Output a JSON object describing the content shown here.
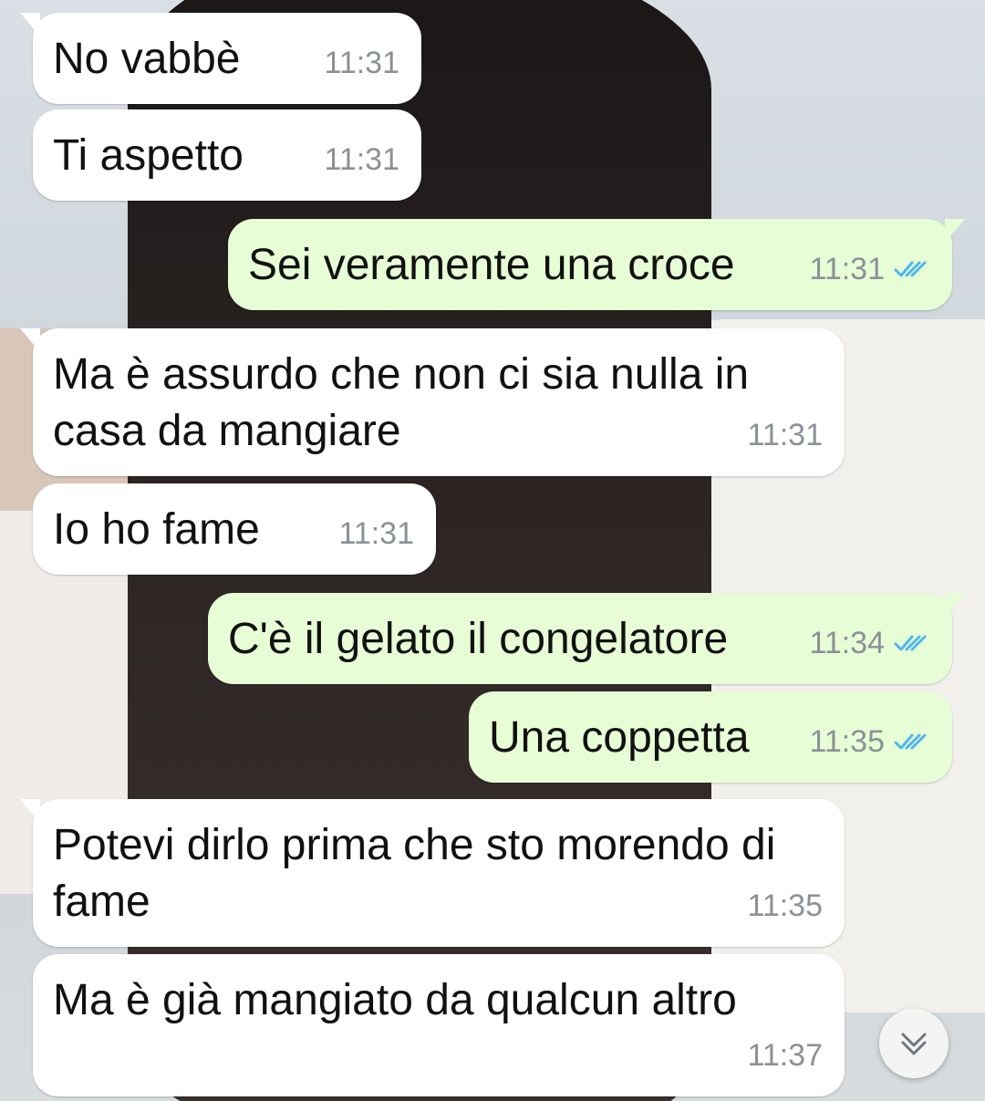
{
  "colors": {
    "incoming_bubble": "#ffffff",
    "outgoing_bubble": "#e7fdd6",
    "read_ticks": "#4fb6ec",
    "timestamp": "#8a9297"
  },
  "messages": [
    {
      "direction": "incoming",
      "text": "No vabbè",
      "time": "11:31"
    },
    {
      "direction": "incoming",
      "text": "Ti aspetto",
      "time": "11:31"
    },
    {
      "direction": "outgoing",
      "text": "Sei veramente una croce",
      "time": "11:31",
      "status_icon": "double-check-read-icon"
    },
    {
      "direction": "incoming",
      "text": "Ma è assurdo che non ci sia nulla in casa da mangiare",
      "time": "11:31"
    },
    {
      "direction": "incoming",
      "text": "Io ho fame",
      "time": "11:31"
    },
    {
      "direction": "outgoing",
      "text": "C'è il gelato il congelatore",
      "time": "11:34",
      "status_icon": "double-check-read-icon"
    },
    {
      "direction": "outgoing",
      "text": "Una coppetta",
      "time": "11:35",
      "status_icon": "double-check-read-icon"
    },
    {
      "direction": "incoming",
      "text": "Potevi dirlo prima che sto morendo di fame",
      "time": "11:35"
    },
    {
      "direction": "incoming",
      "text": "Ma è già mangiato da qualcun altro",
      "time": "11:37"
    }
  ],
  "scroll_button_icon": "chevron-double-down-icon"
}
